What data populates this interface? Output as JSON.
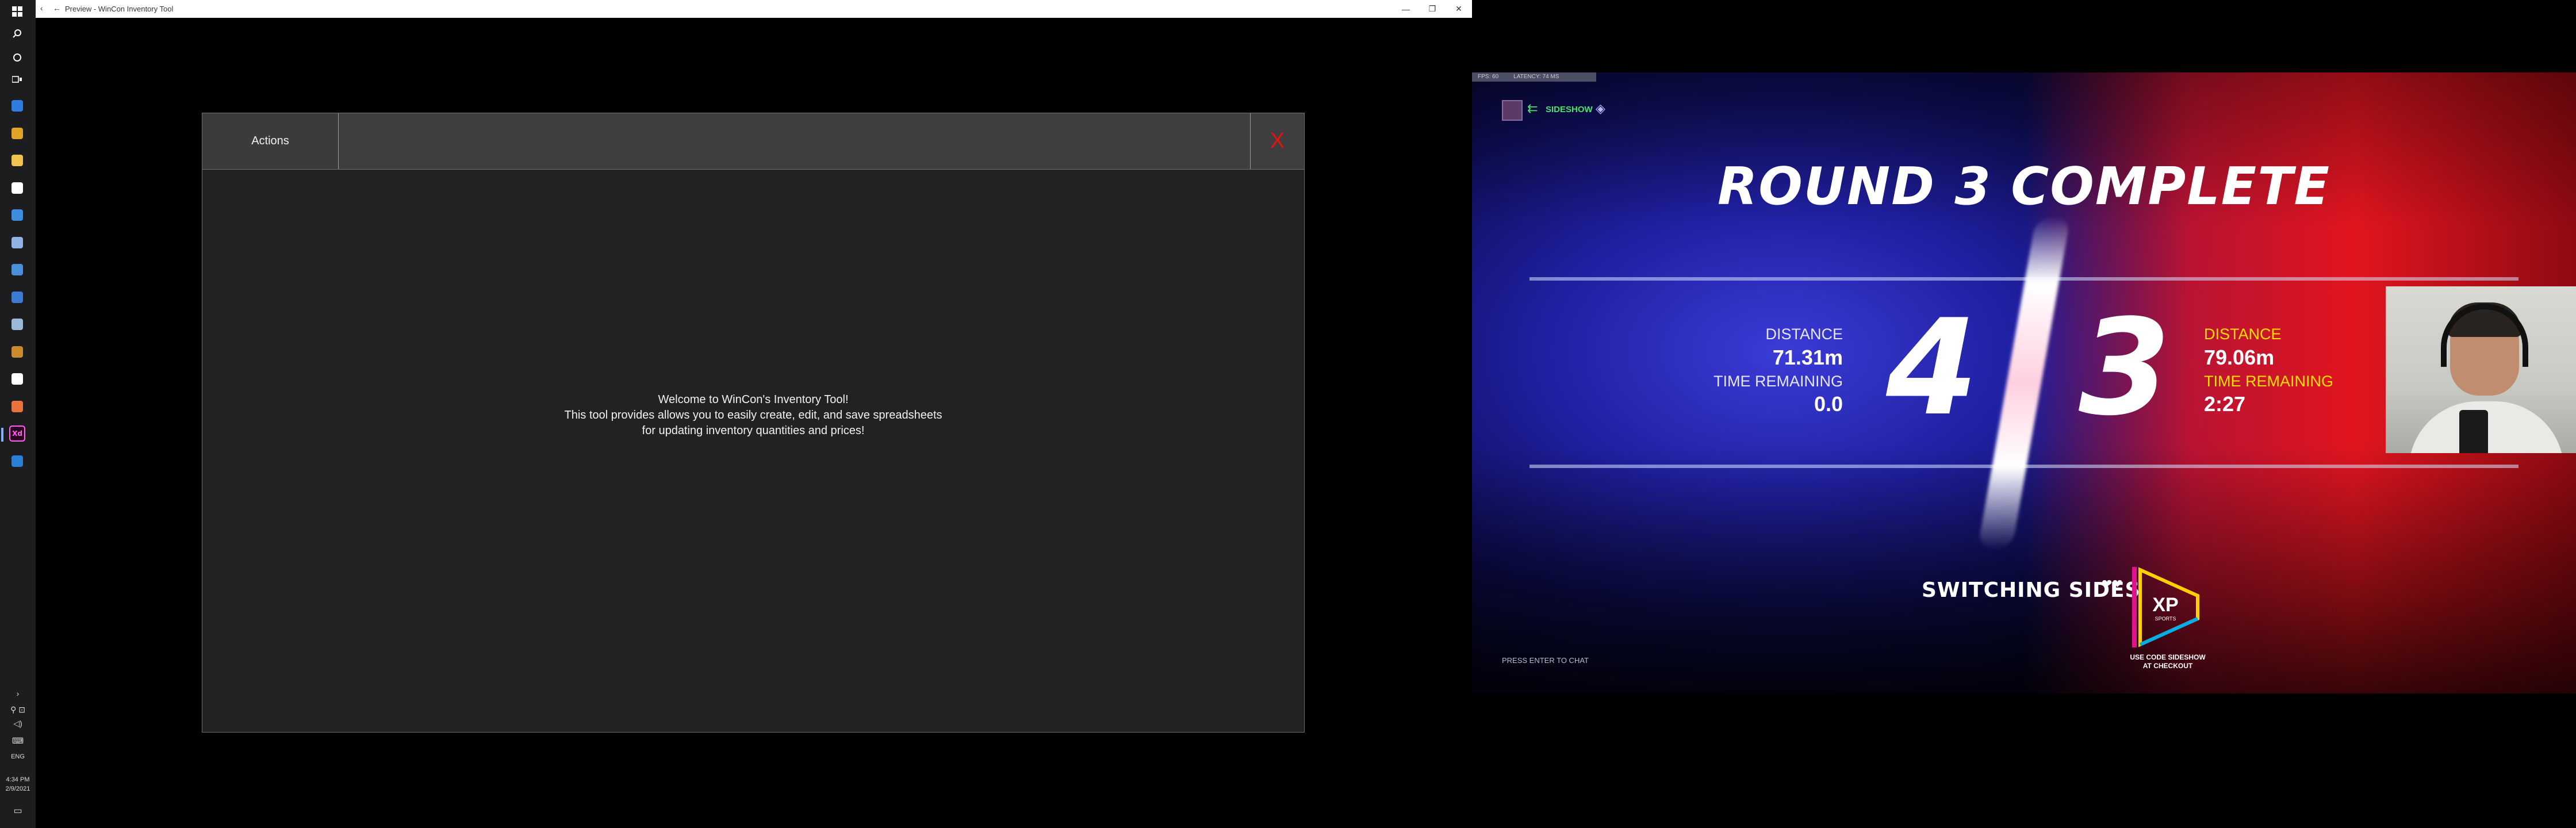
{
  "taskbar": {
    "start_icon": "windows-icon",
    "search_icon": "search-icon",
    "cortana_icon": "circle-icon",
    "taskview_icon": "task-view-icon",
    "apps": [
      {
        "name": "edge-icon",
        "color": "#2f7de1"
      },
      {
        "name": "chrome-icon",
        "color": "#e0a427"
      },
      {
        "name": "file-explorer-icon",
        "color": "#f2c14e"
      },
      {
        "name": "store-icon",
        "color": "#ffffff"
      },
      {
        "name": "mail-icon",
        "color": "#3c8de0"
      },
      {
        "name": "notepad-icon",
        "color": "#8fb4e3"
      },
      {
        "name": "photos-icon",
        "color": "#4a90d9"
      },
      {
        "name": "remote-desktop-icon",
        "color": "#3a7bd5"
      },
      {
        "name": "powershell-icon",
        "color": "#9ab8d8"
      },
      {
        "name": "terminal-icon",
        "color": "#c98b2c"
      },
      {
        "name": "xbox-icon",
        "color": "#ffffff"
      },
      {
        "name": "paint-icon",
        "color": "#e8743b"
      },
      {
        "name": "adobe-xd-icon",
        "color": "#ff61f6",
        "label": "Xd"
      },
      {
        "name": "image-viewer-icon",
        "color": "#2b7fd6"
      }
    ],
    "tray": {
      "language": "ENG",
      "time": "4:34 PM",
      "date": "2/9/2021"
    }
  },
  "preview_window": {
    "title": "Preview - WinCon Inventory Tool",
    "back_icon": "back-arrow-icon",
    "minimize_icon": "minimize-icon",
    "restore_icon": "restore-icon",
    "close_icon": "close-icon"
  },
  "app": {
    "actions_label": "Actions",
    "close_label": "X",
    "welcome_lines": [
      "Welcome to WinCon's Inventory Tool!",
      "This tool provides allows you to easily create, edit, and save spreadsheets",
      "for updating inventory quantities and prices!"
    ],
    "colors": {
      "background": "#222222",
      "header": "#3e3e3e",
      "close": "#e3140f"
    }
  },
  "stream": {
    "stats": {
      "fps": "FPS: 60",
      "latency": "LATENCY: 74 MS"
    },
    "channel": "SIDESHOW",
    "title": "ROUND 3 COMPLETE",
    "left": {
      "score": "4",
      "distance_label": "DISTANCE",
      "distance": "71.31m",
      "time_label": "TIME REMAINING",
      "time": "0.0"
    },
    "right": {
      "score": "3",
      "distance_label": "DISTANCE",
      "distance": "79.06m",
      "time_label": "TIME REMAINING",
      "time": "2:27"
    },
    "switching": "SWITCHING SIDES",
    "switching_hearts": "❤❤",
    "sponsor_logo": "XP",
    "sponsor_sub": "SPORTS",
    "promo_lines": [
      "USE CODE SIDESHOW",
      "AT CHECKOUT"
    ],
    "chat_hint": "PRESS ENTER TO CHAT",
    "colors": {
      "left_team": "#1f1fa0",
      "right_team": "#e1151f",
      "highlight": "#ffe100"
    }
  }
}
